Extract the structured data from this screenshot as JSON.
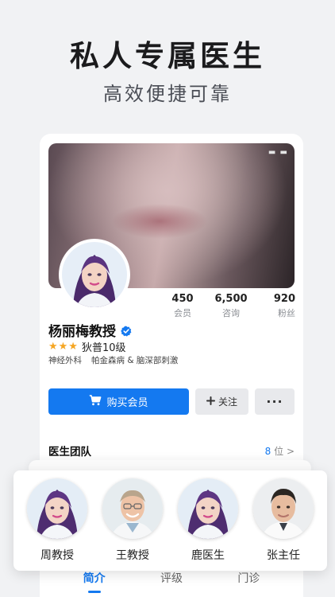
{
  "headline": "私人专属医生",
  "subline": "高效便捷可靠",
  "profile": {
    "cover_menu": "▬ ▬",
    "name": "杨丽梅教授",
    "rating_stars": "★★★",
    "rating_level": "狄普10级",
    "tags": [
      "神经外科",
      "帕金森病 & 脑深部刺激"
    ],
    "stats": [
      {
        "value": "450",
        "label": "会员"
      },
      {
        "value": "6,500",
        "label": "咨询"
      },
      {
        "value": "920",
        "label": "粉丝"
      }
    ]
  },
  "actions": {
    "buy_label": "购买会员",
    "follow_label": "关注",
    "more_label": "···"
  },
  "team": {
    "title": "医生团队",
    "count": "8",
    "count_unit": "位 >",
    "members": [
      {
        "name": "周教授"
      },
      {
        "name": "王教授"
      },
      {
        "name": "鹿医生"
      },
      {
        "name": "张主任"
      }
    ]
  },
  "tabs": [
    "简介",
    "评级",
    "门诊"
  ],
  "icons": {
    "verified": "verified-badge-icon",
    "cart": "cart-icon",
    "plus": "plus-icon",
    "more": "more-icon"
  },
  "colors": {
    "accent": "#1479f0",
    "star": "#f5a623",
    "background": "#f1f2f4"
  }
}
